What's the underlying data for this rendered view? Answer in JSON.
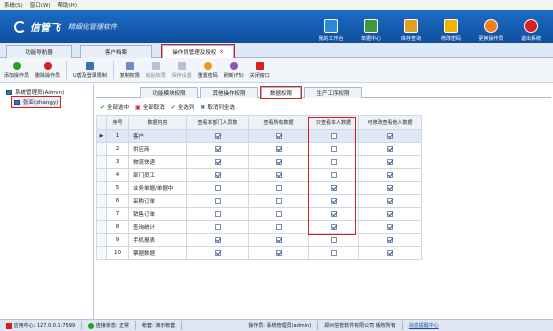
{
  "menubar": [
    "系统(S)",
    "窗口(W)",
    "帮助(H)"
  ],
  "app": {
    "logo": "信管飞",
    "slogan": "精细化管理软件"
  },
  "topnav": [
    {
      "label": "我的工作台",
      "icon": "desktop-icon",
      "color": "#2d8ad6"
    },
    {
      "label": "单据中心",
      "icon": "document-icon",
      "color": "#3c9a3c"
    },
    {
      "label": "库存查询",
      "icon": "warehouse-icon",
      "color": "#e0a020"
    },
    {
      "label": "修改密码",
      "icon": "lock-icon",
      "color": "#f0b400"
    },
    {
      "label": "更换操作员",
      "icon": "user-icon",
      "color": "#f08020"
    },
    {
      "label": "退出系统",
      "icon": "exit-icon",
      "color": "#d82020"
    }
  ],
  "main_tabs": [
    "功能导航器",
    "客户档案",
    "操作员管理及授权"
  ],
  "toolbar": [
    {
      "label": "添加操作员",
      "icon": "add-icon",
      "color": "#2aa02a",
      "disabled": false
    },
    {
      "label": "删除操作员",
      "icon": "delete-icon",
      "color": "#d82020",
      "disabled": false
    },
    {
      "label": "U盾及登录限制",
      "icon": "ukey-icon",
      "color": "#3a6fb6",
      "disabled": false
    },
    {
      "label": "复制权限",
      "icon": "copy-icon",
      "color": "#6d8fbf",
      "disabled": false
    },
    {
      "label": "粘贴权限",
      "icon": "paste-icon",
      "color": "#b7c3d2",
      "disabled": true
    },
    {
      "label": "保存设置",
      "icon": "save-icon",
      "color": "#b7c3d2",
      "disabled": true
    },
    {
      "label": "重置密码",
      "icon": "reset-icon",
      "color": "#e89a1c",
      "disabled": false
    },
    {
      "label": "刷新(F5)",
      "icon": "refresh-icon",
      "color": "#8a56b8",
      "disabled": false
    },
    {
      "label": "关闭窗口",
      "icon": "close-icon",
      "color": "#d82020",
      "disabled": false
    }
  ],
  "tree": [
    {
      "label": "系统管理员(Admin)",
      "selected": false
    },
    {
      "label": "张亚(zhangy)",
      "selected": true
    }
  ],
  "sub_tabs": [
    "功能模块权限",
    "其他操作权限",
    "数据权限",
    "生产工序权限"
  ],
  "actions": [
    {
      "label": "全部选中",
      "icon": "check-all-icon"
    },
    {
      "label": "全部取消",
      "icon": "cancel-all-icon"
    },
    {
      "label": "全选列",
      "icon": "check-column-icon"
    },
    {
      "label": "取消列全选",
      "icon": "cancel-column-icon"
    }
  ],
  "grid": {
    "headers": [
      "",
      "序号",
      "数据内容",
      "查看本部门人员数",
      "查看所有数据",
      "只查看本人数据",
      "可修改查看他人数据"
    ],
    "rows": [
      {
        "no": "1",
        "name": "客户",
        "cols": [
          true,
          true,
          false,
          true
        ],
        "selected": true
      },
      {
        "no": "2",
        "name": "供应商",
        "cols": [
          true,
          true,
          false,
          true
        ],
        "selected": false
      },
      {
        "no": "3",
        "name": "物流快递",
        "cols": [
          true,
          true,
          false,
          true
        ],
        "selected": false
      },
      {
        "no": "4",
        "name": "部门员工",
        "cols": [
          true,
          true,
          false,
          true
        ],
        "selected": false
      },
      {
        "no": "5",
        "name": "业务单据/单据中",
        "cols": [
          false,
          false,
          true,
          true
        ],
        "selected": false
      },
      {
        "no": "6",
        "name": "采购订单",
        "cols": [
          false,
          false,
          true,
          true
        ],
        "selected": false
      },
      {
        "no": "7",
        "name": "销售订单",
        "cols": [
          false,
          false,
          true,
          true
        ],
        "selected": false
      },
      {
        "no": "8",
        "name": "查询统计",
        "cols": [
          false,
          false,
          true,
          true
        ],
        "selected": false
      },
      {
        "no": "9",
        "name": "手机报表",
        "cols": [
          true,
          true,
          false,
          true
        ],
        "selected": false
      },
      {
        "no": "10",
        "name": "票据数据",
        "cols": [
          true,
          true,
          false,
          true
        ],
        "selected": false
      }
    ]
  },
  "status": {
    "server": "应用中心: 127.0.0.1:7599",
    "connection": "连接状态: 正常",
    "account": "帐套: 演示帐套",
    "operator": "操作员: 系统管理员(admin)",
    "company": "郑州信管软件有限公司 版权所有",
    "link": "消息提醒中心"
  }
}
